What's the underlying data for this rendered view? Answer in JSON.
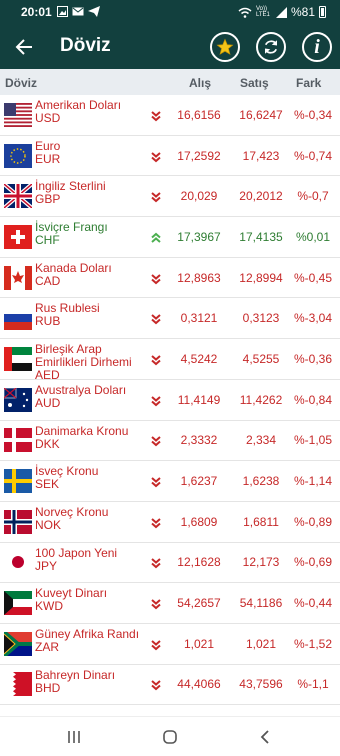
{
  "status": {
    "time": "20:01",
    "battery": "%81",
    "network": "Vo)) LTE1"
  },
  "appbar": {
    "title": "Döviz",
    "back_icon": "arrow-left-icon",
    "fav_icon": "star-icon",
    "refresh_icon": "refresh-icon",
    "info_icon": "info-icon"
  },
  "header": {
    "name": "Döviz",
    "buy": "Alış",
    "sell": "Satış",
    "diff": "Fark"
  },
  "colors": {
    "dark_teal": "#12403e",
    "down_red": "#c62828",
    "up_green": "#2e7d32",
    "star": "#f5c518"
  },
  "rows": [
    {
      "name": "Amerikan Doları",
      "code": "USD",
      "flag": "usa",
      "dir": "down",
      "buy": "16,6156",
      "sell": "16,6247",
      "diff": "%-0,34"
    },
    {
      "name": "Euro",
      "code": "EUR",
      "flag": "eu",
      "dir": "down",
      "buy": "17,2592",
      "sell": "17,423",
      "diff": "%-0,74"
    },
    {
      "name": "İngiliz Sterlini",
      "code": "GBP",
      "flag": "uk",
      "dir": "down",
      "buy": "20,029",
      "sell": "20,2012",
      "diff": "%-0,7"
    },
    {
      "name": "İsviçre Frangı",
      "code": "CHF",
      "flag": "ch",
      "dir": "up",
      "buy": "17,3967",
      "sell": "17,4135",
      "diff": "%0,01"
    },
    {
      "name": "Kanada Doları",
      "code": "CAD",
      "flag": "ca",
      "dir": "down",
      "buy": "12,8963",
      "sell": "12,8994",
      "diff": "%-0,45"
    },
    {
      "name": "Rus Rublesi",
      "code": "RUB",
      "flag": "ru",
      "dir": "down",
      "buy": "0,3121",
      "sell": "0,3123",
      "diff": "%-3,04"
    },
    {
      "name": "Birleşik Arap Emirlikleri Dirhemi",
      "code": "AED",
      "flag": "ae",
      "dir": "down",
      "buy": "4,5242",
      "sell": "4,5255",
      "diff": "%-0,36"
    },
    {
      "name": "Avustralya Doları",
      "code": "AUD",
      "flag": "au",
      "dir": "down",
      "buy": "11,4149",
      "sell": "11,4262",
      "diff": "%-0,84"
    },
    {
      "name": "Danimarka Kronu",
      "code": "DKK",
      "flag": "dk",
      "dir": "down",
      "buy": "2,3332",
      "sell": "2,334",
      "diff": "%-1,05"
    },
    {
      "name": "İsveç Kronu",
      "code": "SEK",
      "flag": "se",
      "dir": "down",
      "buy": "1,6237",
      "sell": "1,6238",
      "diff": "%-1,14"
    },
    {
      "name": "Norveç Kronu",
      "code": "NOK",
      "flag": "no",
      "dir": "down",
      "buy": "1,6809",
      "sell": "1,6811",
      "diff": "%-0,89"
    },
    {
      "name": "100 Japon Yeni",
      "code": "JPY",
      "flag": "jp",
      "dir": "down",
      "buy": "12,1628",
      "sell": "12,173",
      "diff": "%-0,69"
    },
    {
      "name": "Kuveyt Dinarı",
      "code": "KWD",
      "flag": "kw",
      "dir": "down",
      "buy": "54,2657",
      "sell": "54,1186",
      "diff": "%-0,44"
    },
    {
      "name": "Güney Afrika Randı",
      "code": "ZAR",
      "flag": "za",
      "dir": "down",
      "buy": "1,021",
      "sell": "1,021",
      "diff": "%-1,52"
    },
    {
      "name": "Bahreyn Dinarı",
      "code": "BHD",
      "flag": "bh",
      "dir": "down",
      "buy": "44,4066",
      "sell": "43,7596",
      "diff": "%-1,1"
    }
  ],
  "navbar": {
    "recents_icon": "recents-icon",
    "home_icon": "home-icon",
    "back_icon": "back-icon"
  }
}
